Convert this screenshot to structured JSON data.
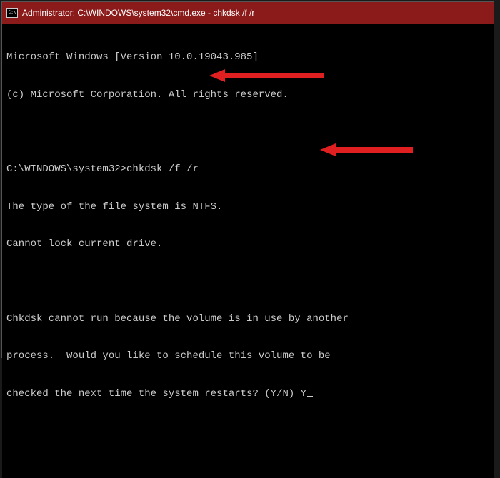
{
  "titlebar": {
    "title": "Administrator: C:\\WINDOWS\\system32\\cmd.exe - chkdsk  /f /r"
  },
  "terminal": {
    "line1": "Microsoft Windows [Version 10.0.19043.985]",
    "line2": "(c) Microsoft Corporation. All rights reserved.",
    "prompt": "C:\\WINDOWS\\system32>",
    "command": "chkdsk /f /r",
    "line4": "The type of the file system is NTFS.",
    "line5": "Cannot lock current drive.",
    "line6": "Chkdsk cannot run because the volume is in use by another",
    "line7": "process.  Would you like to schedule this volume to be",
    "line8": "checked the next time the system restarts? (Y/N) ",
    "response": "Y"
  },
  "colors": {
    "titlebar": "#8B1A1A",
    "arrow": "#E02020"
  }
}
